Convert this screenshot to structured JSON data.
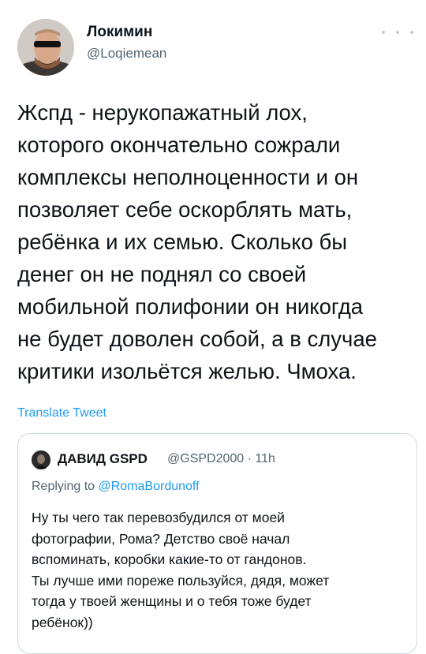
{
  "author": {
    "name": "Локимин",
    "handle": "@Loqiemean"
  },
  "tweet": {
    "lines": [
      "Жспд - нерукопажатный лох,",
      "которого окончательно сожрали",
      "комплексы неполноценности и он",
      "позволяет себе оскорблять мать,",
      "ребёнка и их семью. Сколько бы",
      "денег он не поднял со своей",
      "мобильной полифонии он никогда",
      "не будет доволен собой, а в случае",
      "критики изольётся желью. Чмоха."
    ],
    "translate_label": "Translate Tweet"
  },
  "quote": {
    "name": "ДАВИД GSPD",
    "meta": "@GSPD2000 · 11h",
    "replying_prefix": "Replying to",
    "replying_to": "@RomaBordunoff",
    "lines": [
      "Ну ты чего так перевозбудился от моей",
      "фотографии, Рома? Детство своё начал",
      "вспоминать, коробки какие-то от гандонов.",
      "Ты лучше ими пореже пользуйся, дядя, может",
      "тогда у твоей женщины и о тебя тоже будет",
      "ребёнок))"
    ]
  },
  "icons": {
    "more": "more-horizontal-icon"
  },
  "colors": {
    "link": "#1d9bf0",
    "secondary_text": "#536471",
    "border": "#cfd9de"
  }
}
